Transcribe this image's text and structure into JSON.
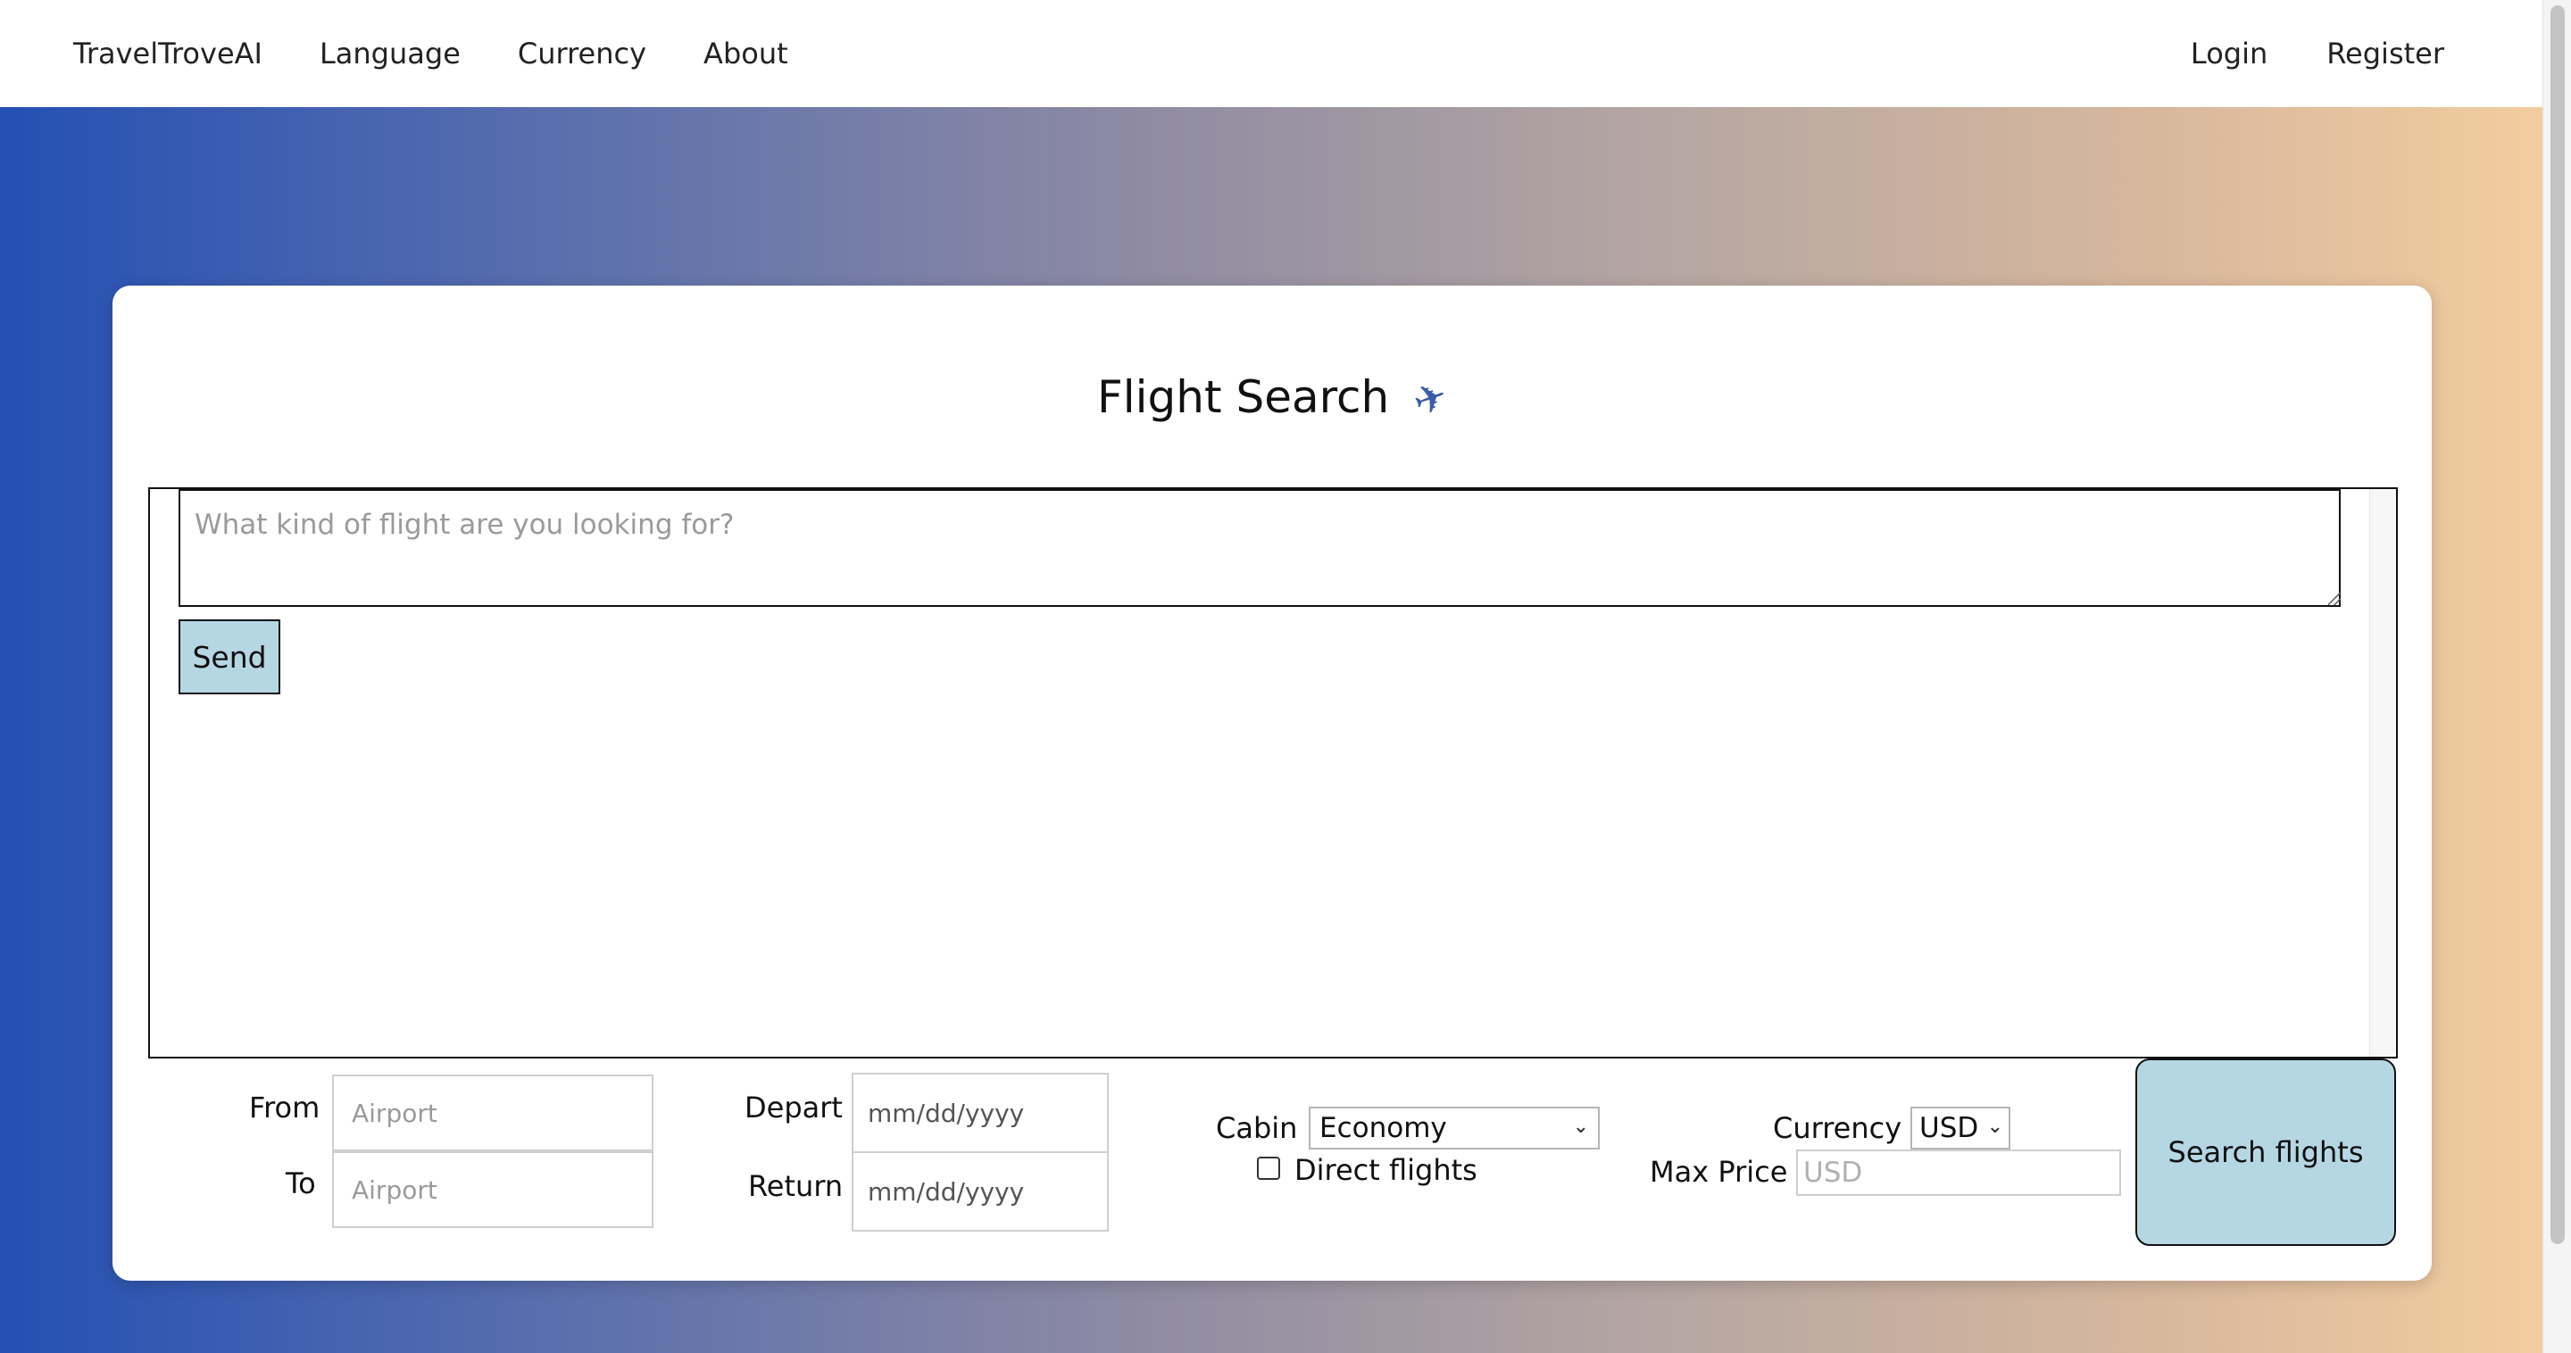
{
  "navbar": {
    "brand": "TravelTroveAI",
    "language": "Language",
    "currency": "Currency",
    "about": "About",
    "login": "Login",
    "register": "Register"
  },
  "page": {
    "title": "Flight Search",
    "title_icon": "airplane-icon"
  },
  "chat": {
    "placeholder": "What kind of flight are you looking for?",
    "send_label": "Send"
  },
  "form": {
    "from_label": "From",
    "from_placeholder": "Airport",
    "to_label": "To",
    "to_placeholder": "Airport",
    "depart_label": "Depart",
    "depart_value": "mm/dd/yyyy",
    "return_label": "Return",
    "return_value": "mm/dd/yyyy",
    "cabin_label": "Cabin",
    "cabin_value": "Economy",
    "direct_label": "Direct flights",
    "direct_checked": false,
    "currency_label": "Currency",
    "currency_value": "USD",
    "maxprice_label": "Max Price",
    "maxprice_placeholder": "USD",
    "search_label": "Search flights"
  },
  "colors": {
    "button_bg": "#b5d7e3",
    "gradient_start": "#2450b4",
    "gradient_end": "#f3cd9f"
  }
}
